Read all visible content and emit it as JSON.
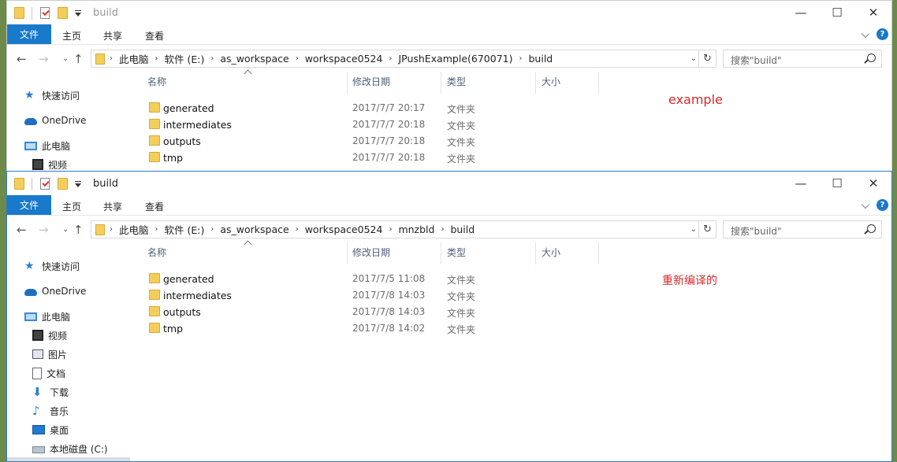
{
  "windows": [
    {
      "title": "build",
      "ribbon": {
        "file": "文件",
        "home": "主页",
        "share": "共享",
        "view": "查看"
      },
      "address": [
        "此电脑",
        "软件 (E:)",
        "as_workspace",
        "workspace0524",
        "JPushExample(670071)",
        "build"
      ],
      "search_placeholder": "搜索\"build\"",
      "columns": {
        "name": "名称",
        "date": "修改日期",
        "type": "类型",
        "size": "大小"
      },
      "sidebar": [
        "快速访问",
        "OneDrive",
        "此电脑",
        "视频"
      ],
      "files": [
        {
          "name": "generated",
          "date": "2017/7/7 20:17",
          "type": "文件夹"
        },
        {
          "name": "intermediates",
          "date": "2017/7/7 20:18",
          "type": "文件夹"
        },
        {
          "name": "outputs",
          "date": "2017/7/7 20:18",
          "type": "文件夹"
        },
        {
          "name": "tmp",
          "date": "2017/7/7 20:18",
          "type": "文件夹"
        }
      ],
      "annotation": "example"
    },
    {
      "title": "build",
      "ribbon": {
        "file": "文件",
        "home": "主页",
        "share": "共享",
        "view": "查看"
      },
      "address": [
        "此电脑",
        "软件 (E:)",
        "as_workspace",
        "workspace0524",
        "mnzbld",
        "build"
      ],
      "search_placeholder": "搜索\"build\"",
      "columns": {
        "name": "名称",
        "date": "修改日期",
        "type": "类型",
        "size": "大小"
      },
      "sidebar": [
        "快速访问",
        "OneDrive",
        "此电脑",
        "视频",
        "图片",
        "文档",
        "下载",
        "音乐",
        "桌面",
        "本地磁盘 (C:)"
      ],
      "files": [
        {
          "name": "generated",
          "date": "2017/7/5 11:08",
          "type": "文件夹"
        },
        {
          "name": "intermediates",
          "date": "2017/7/8 14:03",
          "type": "文件夹"
        },
        {
          "name": "outputs",
          "date": "2017/7/8 14:03",
          "type": "文件夹"
        },
        {
          "name": "tmp",
          "date": "2017/7/8 14:02",
          "type": "文件夹"
        }
      ],
      "annotation": "重新编译的"
    }
  ],
  "icons": {
    "sidebar": [
      "star-icon",
      "onedrive-icon",
      "this-pc-icon",
      "video-icon",
      "pictures-icon",
      "documents-icon",
      "downloads-icon",
      "music-icon",
      "desktop-icon",
      "drive-icon"
    ]
  },
  "colors": {
    "accent": "#1979ca",
    "annotation": "#d42a2a",
    "folder": "#f4ce5a"
  }
}
